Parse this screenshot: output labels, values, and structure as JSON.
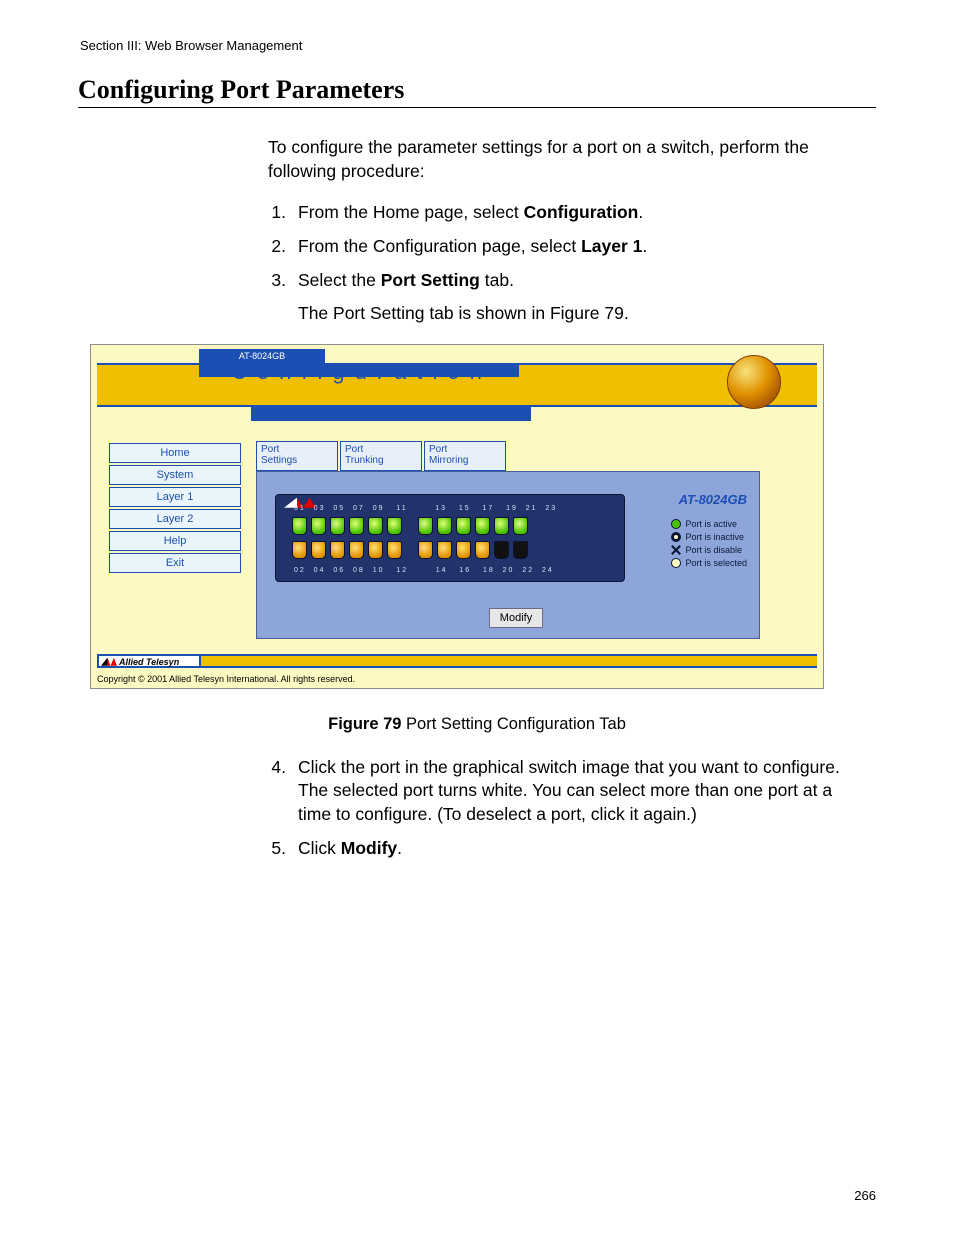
{
  "header": {
    "section": "Section III: Web Browser Management"
  },
  "heading": "Configuring Port Parameters",
  "intro": "To configure the parameter settings for a port on a switch, perform the following procedure:",
  "steps_a": [
    {
      "n": "1.",
      "pre": "From the Home page, select ",
      "bold": "Configuration",
      "post": "."
    },
    {
      "n": "2.",
      "pre": "From the Configuration page, select ",
      "bold": "Layer 1",
      "post": "."
    },
    {
      "n": "3.",
      "pre": "Select the ",
      "bold": "Port Setting",
      "post": " tab."
    }
  ],
  "step3_follow": "The Port Setting tab is shown in Figure 79.",
  "figure": {
    "device_tab": "AT-8024GB",
    "title": "Configuration",
    "nav": [
      "Home",
      "System",
      "Layer 1",
      "Layer 2",
      "Help",
      "Exit"
    ],
    "tabs": [
      {
        "l1": "Port",
        "l2": "Settings"
      },
      {
        "l1": "Port",
        "l2": "Trunking"
      },
      {
        "l1": "Port",
        "l2": "Mirroring"
      }
    ],
    "model": "AT-8024GB",
    "legend": {
      "active": "Port is active",
      "inactive": "Port is inactive",
      "disable": "Port is disable",
      "selected": "Port is selected"
    },
    "rows": {
      "top_nums": "01  03  05  07  09   11       13   15   17   19  21  23",
      "bot_nums": "02  04  06  08  10   12       14   16   18  20  22  24"
    },
    "modify": "Modify",
    "brand": "Allied Telesyn",
    "copyright": "Copyright © 2001 Allied Telesyn International. All rights reserved."
  },
  "caption": {
    "label": "Figure 79",
    "text": "  Port Setting Configuration Tab"
  },
  "steps_b": [
    {
      "n": "4.",
      "text": "Click the port in the graphical switch image that you want to configure. The selected port turns white. You can select more than one port at a time to configure. (To deselect a port, click it again.)"
    },
    {
      "n": "5.",
      "pre": "Click ",
      "bold": "Modify",
      "post": "."
    }
  ],
  "page_number": "266"
}
